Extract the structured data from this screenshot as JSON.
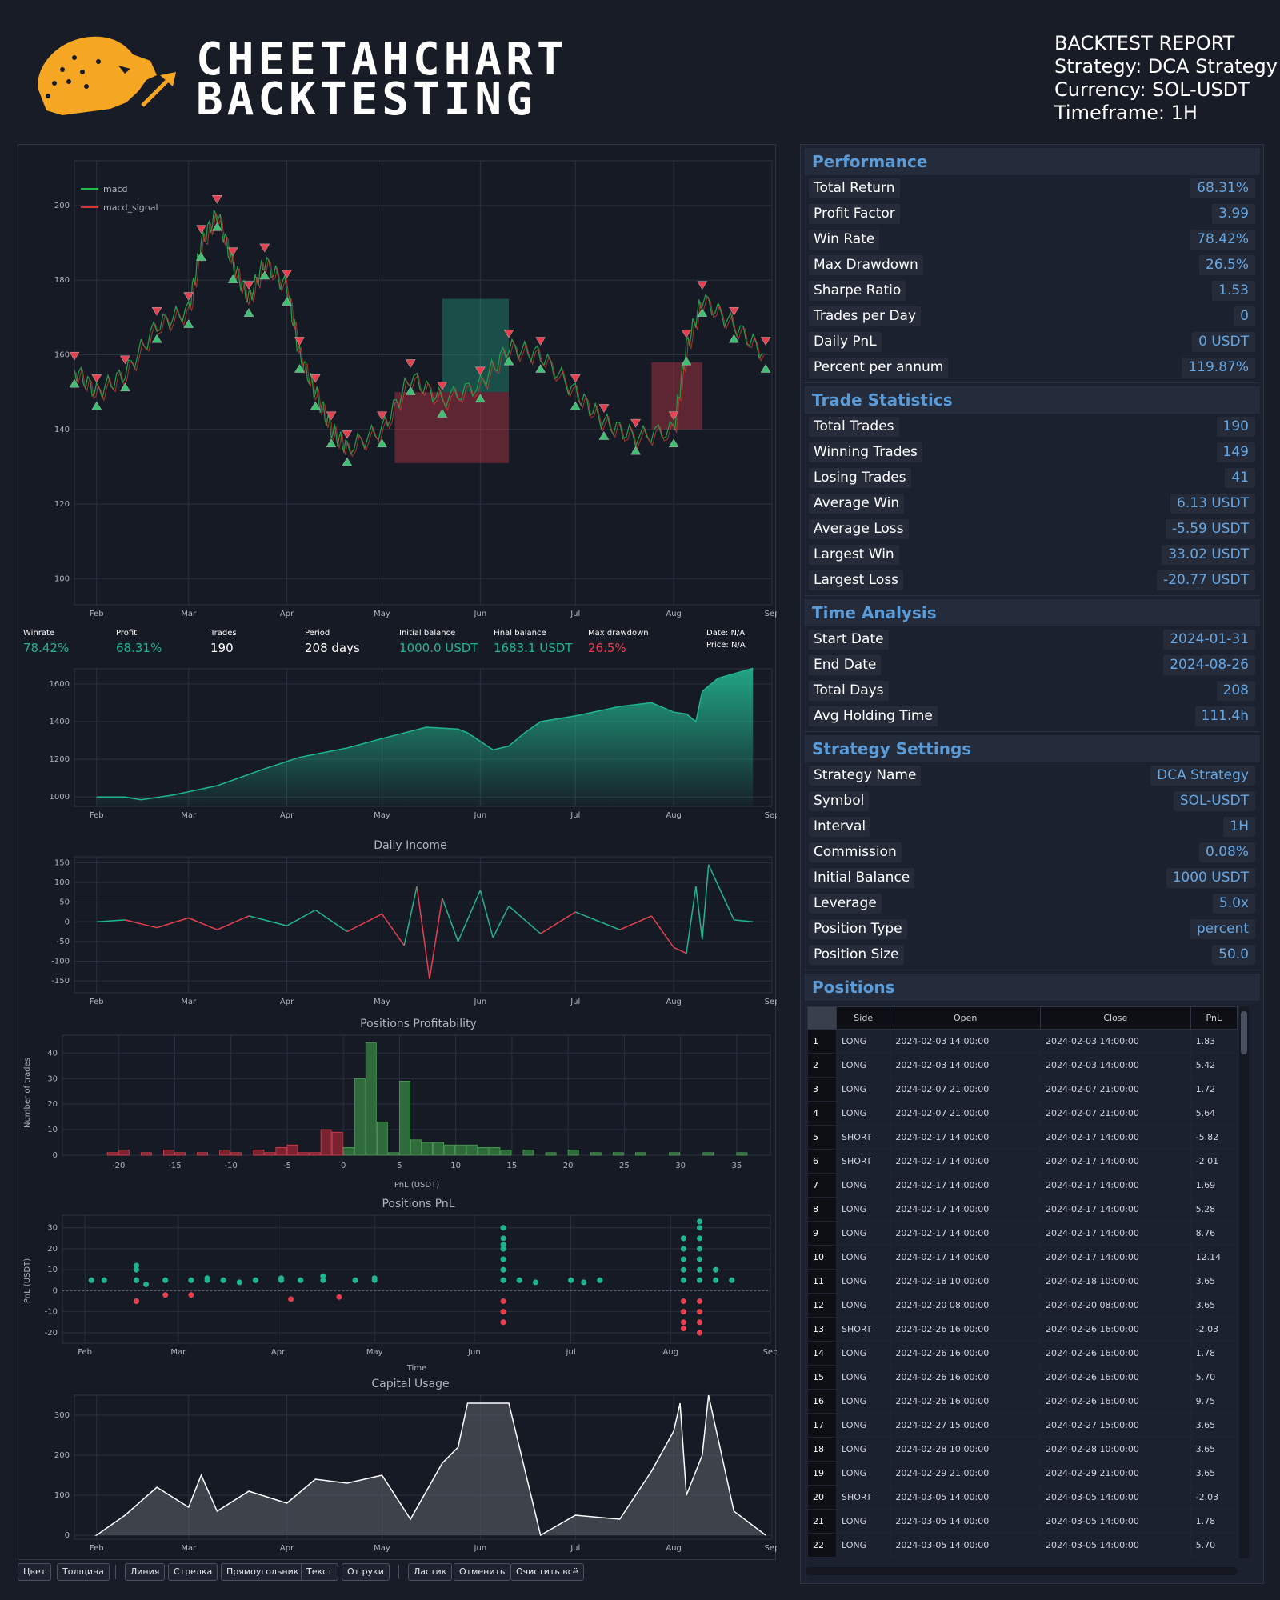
{
  "header": {
    "brand_lines": [
      "CHEETAHCHART",
      "BACKTESTING"
    ],
    "report_title": "BACKTEST REPORT",
    "strategy_line": "Strategy: DCA Strategy",
    "currency_line": "Currency: SOL-USDT",
    "timeframe_line": "Timeframe: 1H"
  },
  "colors": {
    "green": "#21b58e",
    "red": "#e6404f",
    "accent": "#5b9bd8",
    "brand": "#f5a623"
  },
  "summary": {
    "winrate_label": "Winrate",
    "winrate": "78.42%",
    "profit_label": "Profit",
    "profit": "68.31%",
    "trades_label": "Trades",
    "trades": "190",
    "period_label": "Period",
    "period": "208 days",
    "initial_label": "Initial balance",
    "initial": "1000.0 USDT",
    "final_label": "Final balance",
    "final": "1683.1 USDT",
    "maxdd_label": "Max drawdown",
    "maxdd": "26.5%",
    "date_label": "Date: N/A",
    "price_label": "Price: N/A"
  },
  "months": [
    "Feb",
    "Mar",
    "Apr",
    "May",
    "Jun",
    "Jul",
    "Aug",
    "Sep"
  ],
  "chart_data": [
    {
      "type": "line",
      "title": "",
      "legend": [
        "macd",
        "macd_signal"
      ],
      "legend_placement": "top-left",
      "ylim": [
        93,
        212
      ],
      "yticks": [
        100,
        120,
        140,
        160,
        180,
        200
      ],
      "x": [
        "2024-01-25",
        "2024-02-01",
        "2024-02-10",
        "2024-02-20",
        "2024-03-01",
        "2024-03-05",
        "2024-03-10",
        "2024-03-15",
        "2024-03-20",
        "2024-03-25",
        "2024-04-01",
        "2024-04-05",
        "2024-04-10",
        "2024-04-15",
        "2024-04-20",
        "2024-05-01",
        "2024-05-10",
        "2024-05-20",
        "2024-06-01",
        "2024-06-10",
        "2024-06-20",
        "2024-07-01",
        "2024-07-10",
        "2024-07-20",
        "2024-08-01",
        "2024-08-05",
        "2024-08-10",
        "2024-08-20",
        "2024-08-30"
      ],
      "values": [
        156,
        150,
        155,
        168,
        172,
        190,
        198,
        184,
        175,
        185,
        178,
        160,
        150,
        140,
        135,
        140,
        154,
        148,
        152,
        162,
        160,
        150,
        142,
        138,
        140,
        162,
        175,
        168,
        160
      ],
      "grid": true
    },
    {
      "type": "area",
      "title": "",
      "ylim": [
        950,
        1680
      ],
      "yticks": [
        1000,
        1200,
        1400,
        1600
      ],
      "x": [
        "2024-02-01",
        "2024-02-10",
        "2024-02-15",
        "2024-02-25",
        "2024-03-10",
        "2024-03-25",
        "2024-04-05",
        "2024-04-20",
        "2024-05-01",
        "2024-05-15",
        "2024-05-25",
        "2024-05-28",
        "2024-06-05",
        "2024-06-10",
        "2024-06-15",
        "2024-06-20",
        "2024-07-01",
        "2024-07-15",
        "2024-07-25",
        "2024-08-01",
        "2024-08-05",
        "2024-08-08",
        "2024-08-10",
        "2024-08-15",
        "2024-08-26"
      ],
      "values": [
        1000,
        1000,
        985,
        1010,
        1060,
        1150,
        1210,
        1260,
        1310,
        1370,
        1360,
        1340,
        1250,
        1270,
        1340,
        1400,
        1430,
        1480,
        1500,
        1450,
        1440,
        1400,
        1560,
        1630,
        1683
      ],
      "grid": true
    },
    {
      "type": "line",
      "title": "Daily Income",
      "ylim": [
        -180,
        165
      ],
      "yticks": [
        150,
        100,
        50,
        0,
        -50,
        -100,
        -150
      ],
      "x": [
        "2024-02-01",
        "2024-02-10",
        "2024-02-20",
        "2024-03-01",
        "2024-03-10",
        "2024-03-20",
        "2024-04-01",
        "2024-04-10",
        "2024-04-20",
        "2024-05-01",
        "2024-05-08",
        "2024-05-12",
        "2024-05-16",
        "2024-05-20",
        "2024-05-25",
        "2024-06-01",
        "2024-06-05",
        "2024-06-10",
        "2024-06-20",
        "2024-07-01",
        "2024-07-15",
        "2024-07-25",
        "2024-08-01",
        "2024-08-05",
        "2024-08-08",
        "2024-08-10",
        "2024-08-12",
        "2024-08-20",
        "2024-08-26"
      ],
      "values": [
        0,
        5,
        -15,
        10,
        -20,
        15,
        -10,
        30,
        -25,
        20,
        -60,
        90,
        -145,
        60,
        -50,
        80,
        -40,
        40,
        -30,
        25,
        -20,
        15,
        -65,
        -80,
        90,
        -45,
        145,
        5,
        0
      ],
      "grid": true
    },
    {
      "type": "bar",
      "title": "Positions Profitability",
      "xlabel": "PnL (USDT)",
      "ylabel": "Number of trades",
      "xlim": [
        -25,
        38
      ],
      "xticks": [
        -20,
        -15,
        -10,
        -5,
        0,
        5,
        10,
        15,
        20,
        25,
        30,
        35
      ],
      "ylim": [
        0,
        47
      ],
      "yticks": [
        0,
        10,
        20,
        30,
        40
      ],
      "x": [
        -21,
        -20,
        -18,
        -16,
        -15,
        -13,
        -11,
        -10,
        -8,
        -7,
        -6,
        -5,
        -4,
        -3,
        -2,
        -1,
        0,
        1,
        2,
        3,
        4,
        5,
        6,
        7,
        8,
        9,
        10,
        11,
        12,
        13,
        14,
        16,
        18,
        20,
        22,
        24,
        26,
        29,
        32,
        35
      ],
      "values": [
        1,
        2,
        1,
        2,
        1,
        1,
        2,
        1,
        2,
        1,
        3,
        4,
        1,
        1,
        10,
        9,
        3,
        30,
        44,
        13,
        1,
        29,
        6,
        5,
        5,
        4,
        4,
        4,
        3,
        3,
        2,
        2,
        1,
        2,
        1,
        1,
        1,
        1,
        1,
        1
      ],
      "grid": true
    },
    {
      "type": "scatter",
      "title": "Positions PnL",
      "xlabel": "Time",
      "ylabel": "PnL (USDT)",
      "ylim": [
        -25,
        36
      ],
      "yticks": [
        30,
        20,
        10,
        0,
        -10,
        -20
      ],
      "x": [
        "2024-02-03",
        "2024-02-07",
        "2024-02-17",
        "2024-02-17",
        "2024-02-17",
        "2024-02-20",
        "2024-02-26",
        "2024-02-26",
        "2024-03-05",
        "2024-03-05",
        "2024-03-10",
        "2024-03-15",
        "2024-03-20",
        "2024-03-25",
        "2024-04-02",
        "2024-04-05",
        "2024-04-08",
        "2024-04-15",
        "2024-04-20",
        "2024-04-25",
        "2024-05-01",
        "2024-06-10",
        "2024-06-10",
        "2024-06-10",
        "2024-06-15",
        "2024-06-20",
        "2024-07-01",
        "2024-07-05",
        "2024-07-10",
        "2024-08-05",
        "2024-08-05",
        "2024-08-10",
        "2024-08-10",
        "2024-08-15",
        "2024-08-20"
      ],
      "values": [
        5,
        5,
        5,
        12,
        -5,
        3,
        5,
        -2,
        5,
        -2,
        6,
        5,
        4,
        5,
        6,
        -4,
        5,
        7,
        -3,
        5,
        6,
        30,
        -15,
        22,
        5,
        4,
        5,
        4,
        5,
        25,
        -18,
        33,
        -20,
        10,
        5
      ],
      "grid": true
    },
    {
      "type": "area",
      "title": "Capital Usage",
      "ylim": [
        -10,
        350
      ],
      "yticks": [
        0,
        100,
        200,
        300
      ],
      "x": [
        "2024-02-01",
        "2024-02-10",
        "2024-02-20",
        "2024-03-01",
        "2024-03-05",
        "2024-03-10",
        "2024-03-20",
        "2024-04-01",
        "2024-04-10",
        "2024-04-20",
        "2024-05-01",
        "2024-05-10",
        "2024-05-20",
        "2024-05-25",
        "2024-05-28",
        "2024-06-01",
        "2024-06-10",
        "2024-06-20",
        "2024-07-01",
        "2024-07-15",
        "2024-07-25",
        "2024-08-01",
        "2024-08-03",
        "2024-08-05",
        "2024-08-10",
        "2024-08-12",
        "2024-08-20",
        "2024-08-30"
      ],
      "values": [
        0,
        50,
        120,
        70,
        150,
        60,
        110,
        80,
        140,
        130,
        150,
        40,
        180,
        220,
        330,
        330,
        330,
        0,
        50,
        40,
        160,
        260,
        330,
        100,
        200,
        350,
        60,
        0
      ],
      "grid": true
    }
  ],
  "performance": {
    "title": "Performance",
    "rows": [
      {
        "label": "Total Return",
        "value": "68.31%"
      },
      {
        "label": "Profit Factor",
        "value": "3.99"
      },
      {
        "label": "Win Rate",
        "value": "78.42%"
      },
      {
        "label": "Max Drawdown",
        "value": "26.5%"
      },
      {
        "label": "Sharpe Ratio",
        "value": "1.53"
      },
      {
        "label": "Trades per Day",
        "value": "0"
      },
      {
        "label": "Daily PnL",
        "value": "0 USDT"
      },
      {
        "label": "Percent per annum",
        "value": "119.87%"
      }
    ]
  },
  "trade_stats": {
    "title": "Trade Statistics",
    "rows": [
      {
        "label": "Total Trades",
        "value": "190"
      },
      {
        "label": "Winning Trades",
        "value": "149"
      },
      {
        "label": "Losing Trades",
        "value": "41"
      },
      {
        "label": "Average Win",
        "value": "6.13 USDT"
      },
      {
        "label": "Average Loss",
        "value": "-5.59 USDT"
      },
      {
        "label": "Largest Win",
        "value": "33.02 USDT"
      },
      {
        "label": "Largest Loss",
        "value": "-20.77 USDT"
      }
    ]
  },
  "time_analysis": {
    "title": "Time Analysis",
    "rows": [
      {
        "label": "Start Date",
        "value": "2024-01-31"
      },
      {
        "label": "End Date",
        "value": "2024-08-26"
      },
      {
        "label": "Total Days",
        "value": "208"
      },
      {
        "label": "Avg Holding Time",
        "value": "111.4h"
      }
    ]
  },
  "strategy_settings": {
    "title": "Strategy Settings",
    "rows": [
      {
        "label": "Strategy Name",
        "value": "DCA Strategy"
      },
      {
        "label": "Symbol",
        "value": "SOL-USDT"
      },
      {
        "label": "Interval",
        "value": "1H"
      },
      {
        "label": "Commission",
        "value": "0.08%"
      },
      {
        "label": "Initial Balance",
        "value": "1000 USDT"
      },
      {
        "label": "Leverage",
        "value": "5.0x"
      },
      {
        "label": "Position Type",
        "value": "percent"
      },
      {
        "label": "Position Size",
        "value": "50.0"
      }
    ]
  },
  "positions": {
    "title": "Positions",
    "headers": [
      "Side",
      "Open",
      "Close",
      "PnL"
    ],
    "rows": [
      [
        "1",
        "LONG",
        "2024-02-03 14:00:00",
        "2024-02-03 14:00:00",
        "1.83"
      ],
      [
        "2",
        "LONG",
        "2024-02-03 14:00:00",
        "2024-02-03 14:00:00",
        "5.42"
      ],
      [
        "3",
        "LONG",
        "2024-02-07 21:00:00",
        "2024-02-07 21:00:00",
        "1.72"
      ],
      [
        "4",
        "LONG",
        "2024-02-07 21:00:00",
        "2024-02-07 21:00:00",
        "5.64"
      ],
      [
        "5",
        "SHORT",
        "2024-02-17 14:00:00",
        "2024-02-17 14:00:00",
        "-5.82"
      ],
      [
        "6",
        "SHORT",
        "2024-02-17 14:00:00",
        "2024-02-17 14:00:00",
        "-2.01"
      ],
      [
        "7",
        "LONG",
        "2024-02-17 14:00:00",
        "2024-02-17 14:00:00",
        "1.69"
      ],
      [
        "8",
        "LONG",
        "2024-02-17 14:00:00",
        "2024-02-17 14:00:00",
        "5.28"
      ],
      [
        "9",
        "LONG",
        "2024-02-17 14:00:00",
        "2024-02-17 14:00:00",
        "8.76"
      ],
      [
        "10",
        "LONG",
        "2024-02-17 14:00:00",
        "2024-02-17 14:00:00",
        "12.14"
      ],
      [
        "11",
        "LONG",
        "2024-02-18 10:00:00",
        "2024-02-18 10:00:00",
        "3.65"
      ],
      [
        "12",
        "LONG",
        "2024-02-20 08:00:00",
        "2024-02-20 08:00:00",
        "3.65"
      ],
      [
        "13",
        "SHORT",
        "2024-02-26 16:00:00",
        "2024-02-26 16:00:00",
        "-2.03"
      ],
      [
        "14",
        "LONG",
        "2024-02-26 16:00:00",
        "2024-02-26 16:00:00",
        "1.78"
      ],
      [
        "15",
        "LONG",
        "2024-02-26 16:00:00",
        "2024-02-26 16:00:00",
        "5.70"
      ],
      [
        "16",
        "LONG",
        "2024-02-26 16:00:00",
        "2024-02-26 16:00:00",
        "9.75"
      ],
      [
        "17",
        "LONG",
        "2024-02-27 15:00:00",
        "2024-02-27 15:00:00",
        "3.65"
      ],
      [
        "18",
        "LONG",
        "2024-02-28 10:00:00",
        "2024-02-28 10:00:00",
        "3.65"
      ],
      [
        "19",
        "LONG",
        "2024-02-29 21:00:00",
        "2024-02-29 21:00:00",
        "3.65"
      ],
      [
        "20",
        "SHORT",
        "2024-03-05 14:00:00",
        "2024-03-05 14:00:00",
        "-2.03"
      ],
      [
        "21",
        "LONG",
        "2024-03-05 14:00:00",
        "2024-03-05 14:00:00",
        "1.78"
      ],
      [
        "22",
        "LONG",
        "2024-03-05 14:00:00",
        "2024-03-05 14:00:00",
        "5.70"
      ]
    ]
  },
  "toolbar": {
    "buttons": [
      "Цвет",
      "Толщина",
      "Линия",
      "Стрелка",
      "Прямоугольник",
      "Текст",
      "От руки",
      "Ластик",
      "Отменить",
      "Очистить всё"
    ]
  }
}
